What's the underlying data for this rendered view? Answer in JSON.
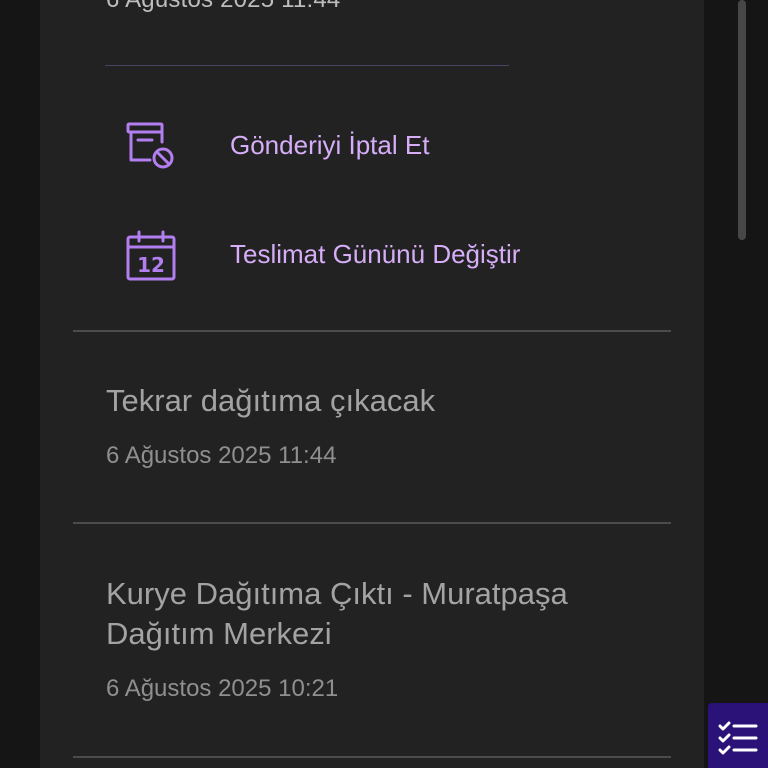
{
  "top_event": {
    "date": "6 Ağustos 2025 11:44"
  },
  "actions": [
    {
      "label": "Gönderiyi İptal Et",
      "icon": "cancel-shipment-icon"
    },
    {
      "label": "Teslimat Gününü Değiştir",
      "icon": "calendar-icon",
      "calendar_day": "12"
    }
  ],
  "events": [
    {
      "title": "Tekrar dağıtıma çıkacak",
      "date": "6 Ağustos 2025 11:44"
    },
    {
      "title": "Kurye Dağıtıma Çıktı - Muratpaşa Dağıtım Merkezi",
      "date": "6 Ağustos 2025 10:21"
    }
  ],
  "fab": {
    "icon": "checklist-icon"
  },
  "colors": {
    "accent": "#b27ef0",
    "accent_text": "#d6adf7",
    "card": "#222222",
    "background": "#151515",
    "fab": "#2a1278"
  }
}
